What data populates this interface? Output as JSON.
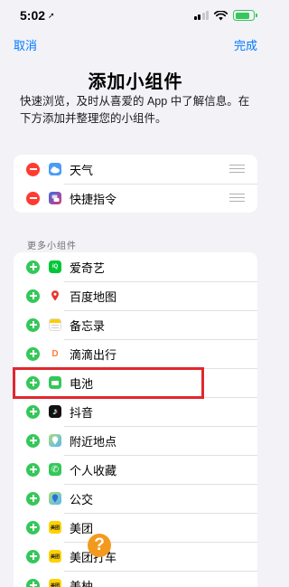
{
  "status_bar": {
    "time": "5:02",
    "location_arrow": "➚"
  },
  "nav": {
    "cancel": "取消",
    "done": "完成"
  },
  "header": {
    "title": "添加小组件",
    "subtitle": "快速浏览，及时从喜爱的 App 中了解信息。在下方添加并整理您的小组件。"
  },
  "current_widgets": [
    {
      "label": "天气",
      "icon": "weather-icon",
      "color": "#4a9cf5"
    },
    {
      "label": "快捷指令",
      "icon": "shortcuts-icon",
      "color": "#5e3fbe"
    }
  ],
  "more_section": {
    "header": "更多小组件",
    "items": [
      {
        "label": "爱奇艺",
        "icon": "iqiyi-icon",
        "color": "#00c739",
        "glyph": "iQ"
      },
      {
        "label": "百度地图",
        "icon": "baidu-map-icon",
        "color": "#ffffff",
        "glyph": "📍"
      },
      {
        "label": "备忘录",
        "icon": "notes-icon",
        "color": "#ffffff"
      },
      {
        "label": "滴滴出行",
        "icon": "didi-icon",
        "color": "#ffffff",
        "glyph": "D"
      },
      {
        "label": "电池",
        "icon": "battery-widget-icon",
        "color": "#34c759"
      },
      {
        "label": "抖音",
        "icon": "douyin-icon",
        "color": "#111111",
        "glyph": "♪"
      },
      {
        "label": "附近地点",
        "icon": "nearby-places-icon",
        "color": "#5ab6f5"
      },
      {
        "label": "个人收藏",
        "icon": "favorites-icon",
        "color": "#34c759",
        "glyph": "✆"
      },
      {
        "label": "公交",
        "icon": "transit-icon",
        "color": "#5ab6f5"
      },
      {
        "label": "美团",
        "icon": "meituan-icon",
        "color": "#ffd100",
        "glyph": "美团"
      },
      {
        "label": "美团打车",
        "icon": "meituan-taxi-icon",
        "color": "#ffd100",
        "glyph": "美团"
      },
      {
        "label": "美柚",
        "icon": "meiyou-icon",
        "color": "#ffd100",
        "glyph": "美团"
      }
    ]
  },
  "highlighted_item": "电池",
  "watermark": {
    "glyph": "?"
  },
  "colors": {
    "accent": "#007aff",
    "add": "#34c759",
    "remove": "#ff3b30",
    "highlight": "#e0282e"
  }
}
